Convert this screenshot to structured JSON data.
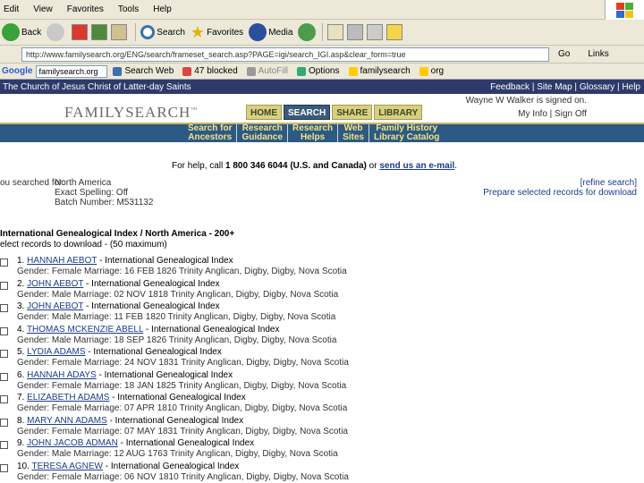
{
  "menu": [
    "Edit",
    "View",
    "Favorites",
    "Tools",
    "Help"
  ],
  "toolbar": {
    "back": "Back",
    "search": "Search",
    "favorites": "Favorites",
    "media": "Media"
  },
  "address": {
    "url": "http://www.familysearch.org/ENG/search/frameset_search.asp?PAGE=igi/search_IGI.asp&clear_form=true",
    "go": "Go",
    "links": "Links"
  },
  "googlebar": {
    "logo": "Google",
    "query": "familysearch.org",
    "search_web": "Search Web",
    "blocked": "47 blocked",
    "autofill": "AutoFill",
    "options": "Options",
    "b1": "familysearch",
    "b2": "org"
  },
  "site": {
    "church": "The Church of Jesus Christ of Latter-day Saints",
    "toplinks": "Feedback | Site Map | Glossary | Help",
    "logo": "FAMILYSEARCH",
    "tabs": [
      "HOME",
      "SEARCH",
      "SHARE",
      "LIBRARY"
    ],
    "signed_in": "Wayne W Walker is signed on.",
    "account": "My Info | Sign Off",
    "subnav": [
      {
        "l1": "Search for",
        "l2": "Ancestors"
      },
      {
        "l1": "Research",
        "l2": "Guidance"
      },
      {
        "l1": "Research",
        "l2": "Helps"
      },
      {
        "l1": "Web",
        "l2": "Sites"
      },
      {
        "l1": "Family History",
        "l2": "Library Catalog"
      }
    ]
  },
  "help": {
    "prefix": "For help, call ",
    "phone": "1 800 346 6044 (U.S. and Canada)",
    "or": " or ",
    "link": "send us an e-mail",
    "suffix": "."
  },
  "searched": {
    "label": "ou searched for:",
    "region": "North America",
    "spelling": "Exact Spelling: Off",
    "batch": "Batch Number: M531132",
    "refine": "[refine search]",
    "download": "Prepare selected records for download"
  },
  "results": {
    "title": "International Genealogical Index / North America - 200+",
    "select_note": "elect records to download - (50 maximum)",
    "rows": [
      {
        "num": "1.",
        "name": "HANNAH AEBOT",
        "src": " - International Genealogical Index",
        "detail": "Gender: Female Marriage: 16 FEB 1826 Trinity Anglican, Digby, Digby, Nova Scotia"
      },
      {
        "num": "2.",
        "name": "JOHN AEBOT",
        "src": " - International Genealogical Index",
        "detail": "Gender: Male Marriage: 02 NOV 1818 Trinity Anglican, Digby, Digby, Nova Scotia"
      },
      {
        "num": "3.",
        "name": "JOHN AEBOT",
        "src": " - International Genealogical Index",
        "detail": "Gender: Male Marriage: 11 FEB 1820 Trinity Anglican, Digby, Digby, Nova Scotia"
      },
      {
        "num": "4.",
        "name": "THOMAS MCKENZIE ABELL",
        "src": " - International Genealogical Index",
        "detail": "Gender: Male Marriage: 18 SEP 1826 Trinity Anglican, Digby, Digby, Nova Scotia"
      },
      {
        "num": "5.",
        "name": "LYDIA ADAMS",
        "src": " - International Genealogical Index",
        "detail": "Gender: Female Marriage: 24 NOV 1831 Trinity Anglican, Digby, Digby, Nova Scotia"
      },
      {
        "num": "6.",
        "name": "HANNAH ADAYS",
        "src": " - International Genealogical Index",
        "detail": "Gender: Female Marriage: 18 JAN 1825 Trinity Anglican, Digby, Digby, Nova Scotia"
      },
      {
        "num": "7.",
        "name": "ELIZABETH ADAMS",
        "src": " - International Genealogical Index",
        "detail": "Gender: Female Marriage: 07 APR 1810 Trinity Anglican, Digby, Digby, Nova Scotia"
      },
      {
        "num": "8.",
        "name": "MARY ANN ADAMS",
        "src": " - International Genealogical Index",
        "detail": "Gender: Female Marriage: 07 MAY 1831 Trinity Anglican, Digby, Digby, Nova Scotia"
      },
      {
        "num": "9.",
        "name": "JOHN JACOB ADMAN",
        "src": " - International Genealogical Index",
        "detail": "Gender: Male Marriage: 12 AUG 1763 Trinity Anglican, Digby, Digby, Nova Scotia"
      },
      {
        "num": "10.",
        "name": "TERESA AGNEW",
        "src": " - International Genealogical Index",
        "detail": "Gender: Female Marriage: 06 NOV 1810 Trinity Anglican, Digby, Digby, Nova Scotia"
      }
    ]
  },
  "colors": {
    "chrome": "#ece9d8",
    "church_bar": "#2f3a6b",
    "subnav": "#2d5a82",
    "subnav_text": "#f2e38a",
    "tab": "#d9cf83",
    "tab_active": "#3a5a7a",
    "link": "#1a3c8c"
  }
}
